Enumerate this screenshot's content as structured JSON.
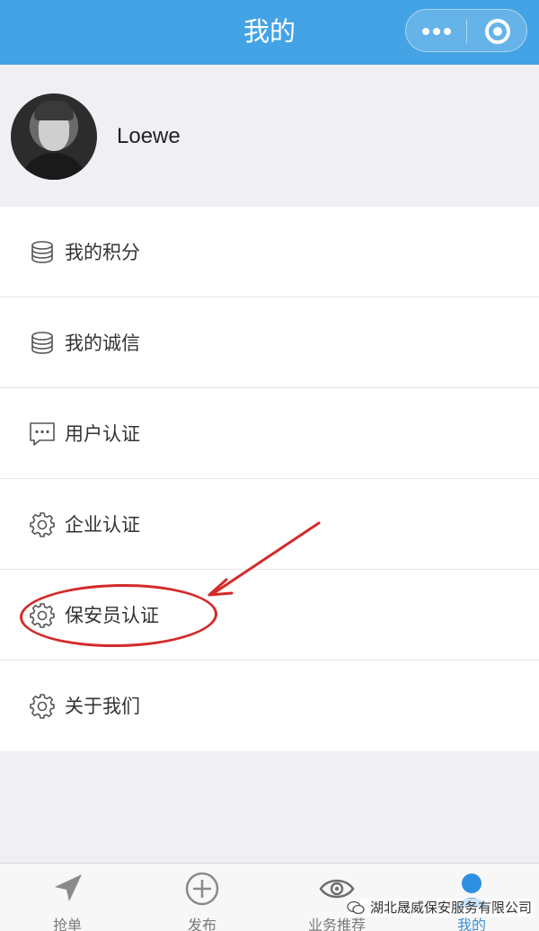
{
  "header": {
    "title": "我的"
  },
  "profile": {
    "username": "Loewe"
  },
  "menu": {
    "items": [
      {
        "label": "我的积分",
        "icon": "coins-icon"
      },
      {
        "label": "我的诚信",
        "icon": "coins-icon"
      },
      {
        "label": "用户认证",
        "icon": "chat-bubble-icon"
      },
      {
        "label": "企业认证",
        "icon": "gear-icon"
      },
      {
        "label": "保安员认证",
        "icon": "gear-icon"
      },
      {
        "label": "关于我们",
        "icon": "gear-icon"
      }
    ]
  },
  "tabs": [
    {
      "label": "抢单",
      "icon": "navigation-arrow-icon"
    },
    {
      "label": "发布",
      "icon": "plus-circle-icon"
    },
    {
      "label": "业务推荐",
      "icon": "eye-icon"
    },
    {
      "label": "我的",
      "icon": "user-icon",
      "active": true
    }
  ],
  "watermark": {
    "text": "湖北晟威保安服务有限公司"
  },
  "colors": {
    "accent": "#44a3e5",
    "annotation": "#d42a2a",
    "active_tab": "#3d8fd8"
  }
}
